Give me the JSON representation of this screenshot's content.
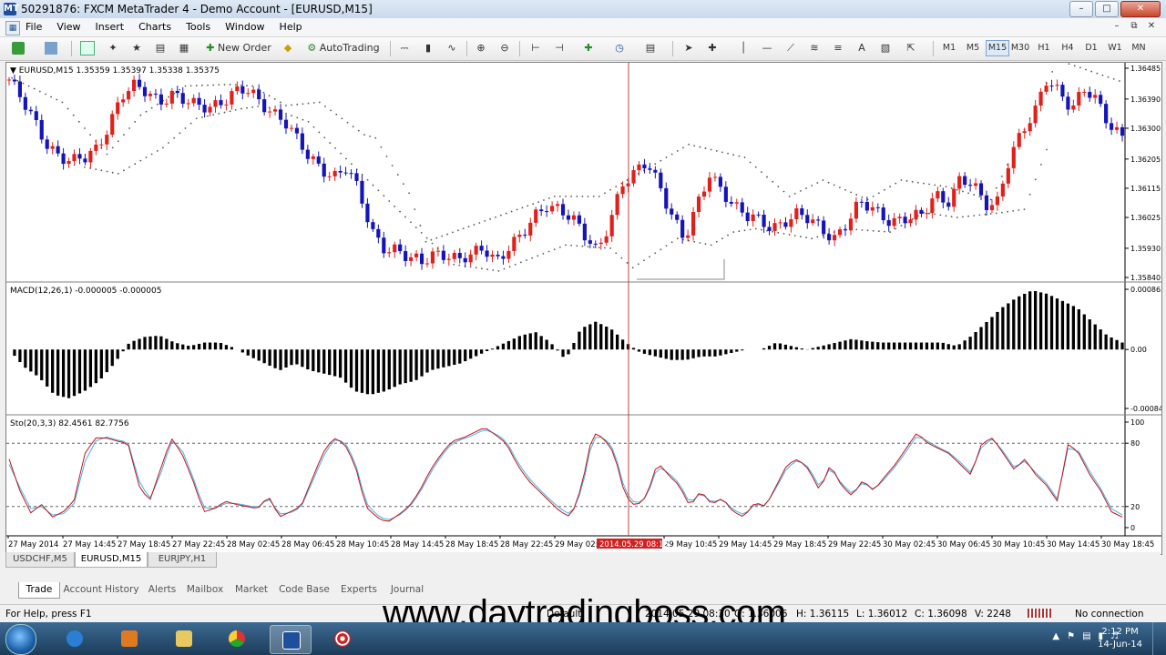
{
  "window": {
    "title": "50291876: FXCM MetaTrader 4 - Demo Account - [EURUSD,M15]",
    "app_icon": "MT"
  },
  "menu": {
    "items": [
      "File",
      "View",
      "Insert",
      "Charts",
      "Tools",
      "Window",
      "Help"
    ]
  },
  "toolbar": {
    "new_order": "New Order",
    "autotrading": "AutoTrading",
    "timeframes": [
      "M1",
      "M5",
      "M15",
      "M30",
      "H1",
      "H4",
      "D1",
      "W1",
      "MN"
    ],
    "selected_timeframe": "M15",
    "text_tool": "A"
  },
  "chart_data": {
    "type": "candlestick",
    "instrument_label": "EURUSD,M15",
    "ohlc_readout": "1.35359 1.35397 1.35338 1.35375",
    "price_ticks": [
      "1.36485",
      "1.36390",
      "1.36300",
      "1.36205",
      "1.36115",
      "1.36025",
      "1.35930",
      "1.35840"
    ],
    "price_range": [
      1.3584,
      1.36485
    ],
    "close_path": [
      1.3645,
      1.3638,
      1.3632,
      1.3626,
      1.3622,
      1.3619,
      1.362,
      1.3624,
      1.3632,
      1.364,
      1.3642,
      1.3641,
      1.3639,
      1.3641,
      1.3638,
      1.3636,
      1.3637,
      1.3639,
      1.3641,
      1.3641,
      1.3638,
      1.3636,
      1.3633,
      1.3626,
      1.362,
      1.3618,
      1.3616,
      1.3618,
      1.3609,
      1.3598,
      1.3594,
      1.3593,
      1.3589,
      1.3588,
      1.3592,
      1.3592,
      1.3589,
      1.359,
      1.3593,
      1.359,
      1.3594,
      1.3596,
      1.3602,
      1.3607,
      1.3606,
      1.3602,
      1.3596,
      1.3592,
      1.3602,
      1.3613,
      1.3615,
      1.3619,
      1.3613,
      1.3604,
      1.3595,
      1.3605,
      1.3616,
      1.3612,
      1.3606,
      1.3602,
      1.3601,
      1.36,
      1.3602,
      1.3603,
      1.3601,
      1.3599,
      1.3597,
      1.3601,
      1.3606,
      1.3605,
      1.3603,
      1.3602,
      1.3602,
      1.3602,
      1.361,
      1.3608,
      1.3614,
      1.3612,
      1.3606,
      1.3608,
      1.3622,
      1.3628,
      1.3634,
      1.3646,
      1.3642,
      1.3636,
      1.3641,
      1.3638,
      1.3632,
      1.3628
    ],
    "psar_upper": [
      [
        0.005,
        1.36455
      ],
      [
        0.05,
        1.3638
      ],
      [
        0.09,
        1.3622
      ],
      [
        0.12,
        1.3634
      ],
      [
        0.16,
        1.3643
      ],
      [
        0.2,
        1.36435
      ],
      [
        0.22,
        1.3643
      ],
      [
        0.25,
        1.3637
      ],
      [
        0.28,
        1.3638
      ],
      [
        0.32,
        1.3628
      ],
      [
        0.33,
        1.3627
      ],
      [
        0.36,
        1.361
      ],
      [
        0.375,
        1.3595
      ],
      [
        0.49,
        1.3609
      ],
      [
        0.53,
        1.3609
      ],
      [
        0.61,
        1.3625
      ],
      [
        0.66,
        1.3621
      ],
      [
        0.7,
        1.3609
      ],
      [
        0.73,
        1.3614
      ],
      [
        0.77,
        1.3608
      ],
      [
        0.8,
        1.3614
      ],
      [
        0.84,
        1.3612
      ],
      [
        0.87,
        1.3609
      ],
      [
        0.88,
        1.3608
      ],
      [
        0.94,
        1.3651
      ],
      [
        1.0,
        1.3644
      ]
    ],
    "psar_lower": [
      [
        0.07,
        1.3618
      ],
      [
        0.1,
        1.3616
      ],
      [
        0.14,
        1.3624
      ],
      [
        0.17,
        1.3633
      ],
      [
        0.21,
        1.3636
      ],
      [
        0.23,
        1.3637
      ],
      [
        0.27,
        1.3632
      ],
      [
        0.4,
        1.3588
      ],
      [
        0.44,
        1.3586
      ],
      [
        0.47,
        1.359
      ],
      [
        0.5,
        1.3594
      ],
      [
        0.54,
        1.3593
      ],
      [
        0.56,
        1.3587
      ],
      [
        0.6,
        1.3596
      ],
      [
        0.63,
        1.3594
      ],
      [
        0.65,
        1.3598
      ],
      [
        0.67,
        1.3599
      ],
      [
        0.72,
        1.3596
      ],
      [
        0.75,
        1.3599
      ],
      [
        0.79,
        1.3598
      ],
      [
        0.82,
        1.3604
      ],
      [
        0.85,
        1.36025
      ],
      [
        0.89,
        1.3604
      ],
      [
        0.91,
        1.3605
      ],
      [
        0.935,
        1.3628
      ]
    ],
    "crosshair_price": "1.35840",
    "macd": {
      "label": "MACD(12,26,1) -0.000005 -0.000005",
      "ticks": [
        "0.000865",
        "0.00",
        "-0.000847"
      ],
      "range": [
        -0.000847,
        0.000865
      ],
      "path": [
        0.0,
        -0.00025,
        -0.0004,
        -0.00065,
        -0.0007,
        -0.0006,
        -0.00045,
        -0.0002,
        0.0001,
        0.00018,
        0.0002,
        0.0001,
        5e-05,
        0.0001,
        0.0001,
        2e-05,
        -0.0001,
        -0.0002,
        -0.0003,
        -0.0002,
        -0.0003,
        -0.00035,
        -0.0004,
        -0.0006,
        -0.00065,
        -0.0006,
        -0.0005,
        -0.00045,
        -0.0003,
        -0.00025,
        -0.0002,
        -0.0001,
        0.0,
        0.0001,
        0.0002,
        0.00025,
        0.0001,
        -0.00015,
        0.0003,
        0.0004,
        0.0003,
        0.0001,
        -5e-05,
        -0.0001,
        -0.00015,
        -0.00015,
        -0.0001,
        -0.0001,
        -5e-05,
        0.0,
        0.0,
        0.0001,
        5e-05,
        0.0,
        5e-05,
        0.0001,
        0.00015,
        0.00012,
        0.0001,
        0.0001,
        0.0001,
        0.0001,
        0.0001,
        5e-05,
        0.0002,
        0.0004,
        0.0006,
        0.00075,
        0.00085,
        0.0008,
        0.0007,
        0.0006,
        0.0004,
        0.0002,
        0.0001
      ]
    },
    "stochastic": {
      "label": "Sto(20,3,3) 82.4561 82.7756",
      "ticks": [
        "100",
        "80",
        "20",
        "0"
      ],
      "levels": [
        80,
        20
      ],
      "main_path": [
        65,
        35,
        14,
        22,
        10,
        15,
        25,
        70,
        85,
        85,
        82,
        80,
        40,
        25,
        55,
        85,
        70,
        45,
        15,
        18,
        25,
        22,
        20,
        18,
        30,
        10,
        15,
        20,
        45,
        70,
        85,
        80,
        60,
        20,
        10,
        5,
        12,
        20,
        35,
        55,
        70,
        82,
        85,
        90,
        95,
        88,
        80,
        60,
        45,
        35,
        25,
        15,
        10,
        40,
        90,
        85,
        70,
        30,
        20,
        30,
        62,
        50,
        40,
        20,
        35,
        22,
        28,
        15,
        10,
        24,
        20,
        40,
        60,
        65,
        55,
        35,
        60,
        40,
        30,
        45,
        35,
        48,
        60,
        75,
        90,
        80,
        75,
        70,
        60,
        50,
        80,
        85,
        70,
        55,
        65,
        50,
        40,
        25,
        80,
        70,
        50,
        35,
        15,
        10
      ],
      "signal_path": [
        60,
        38,
        18,
        20,
        12,
        13,
        22,
        62,
        82,
        86,
        83,
        81,
        45,
        27,
        50,
        82,
        74,
        48,
        19,
        18,
        23,
        23,
        21,
        19,
        28,
        13,
        14,
        19,
        42,
        66,
        83,
        82,
        63,
        24,
        12,
        7,
        11,
        19,
        33,
        52,
        68,
        80,
        84,
        88,
        93,
        89,
        82,
        63,
        48,
        37,
        27,
        18,
        12,
        36,
        85,
        86,
        73,
        34,
        22,
        29,
        58,
        52,
        42,
        23,
        33,
        24,
        27,
        17,
        12,
        22,
        21,
        38,
        57,
        64,
        57,
        38,
        57,
        42,
        32,
        43,
        36,
        46,
        58,
        72,
        87,
        82,
        76,
        71,
        62,
        52,
        77,
        84,
        72,
        57,
        63,
        52,
        42,
        27,
        76,
        72,
        53,
        37,
        18,
        12
      ]
    },
    "time_labels": [
      "27 May 2014",
      "27 May 14:45",
      "27 May 18:45",
      "27 May 22:45",
      "28 May 02:45",
      "28 May 06:45",
      "28 May 10:45",
      "28 May 14:45",
      "28 May 18:45",
      "28 May 22:45",
      "29 May 02:45",
      "29 May 10:45",
      "29 May 14:45",
      "29 May 18:45",
      "29 May 22:45",
      "30 May 02:45",
      "30 May 06:45",
      "30 May 10:45",
      "30 May 14:45",
      "30 May 18:45"
    ],
    "crosshair_time": "2014.05.29 08:15",
    "colors": {
      "bull": "#e0201a",
      "bear": "#1414b8",
      "psar": "#555555",
      "macd": "#000000",
      "sto_main": "#4ab0e0",
      "sto_signal": "#c0141c",
      "crosshair": "#c04040"
    }
  },
  "chart_tabs": [
    "USDCHF,M5",
    "EURUSD,M15",
    "EURJPY,H1"
  ],
  "active_chart_tab": "EURUSD,M15",
  "terminal": {
    "tabs": [
      "Trade",
      "Account History",
      "Alerts",
      "Mailbox",
      "Market",
      "Code Base",
      "Experts",
      "Journal"
    ],
    "active_tab": "Trade"
  },
  "status": {
    "help": "For Help, press F1",
    "profile": "Default",
    "datetime": "2014.05.29 08:30",
    "open": "O: 1.36006",
    "high": "H: 1.36115",
    "low": "L: 1.36012",
    "close": "C: 1.36098",
    "volume": "V: 2248",
    "connection": "No connection"
  },
  "watermark": "www.daytradingboss.com",
  "taskbar": {
    "time": "2:12 PM",
    "date": "14-Jun-14"
  }
}
